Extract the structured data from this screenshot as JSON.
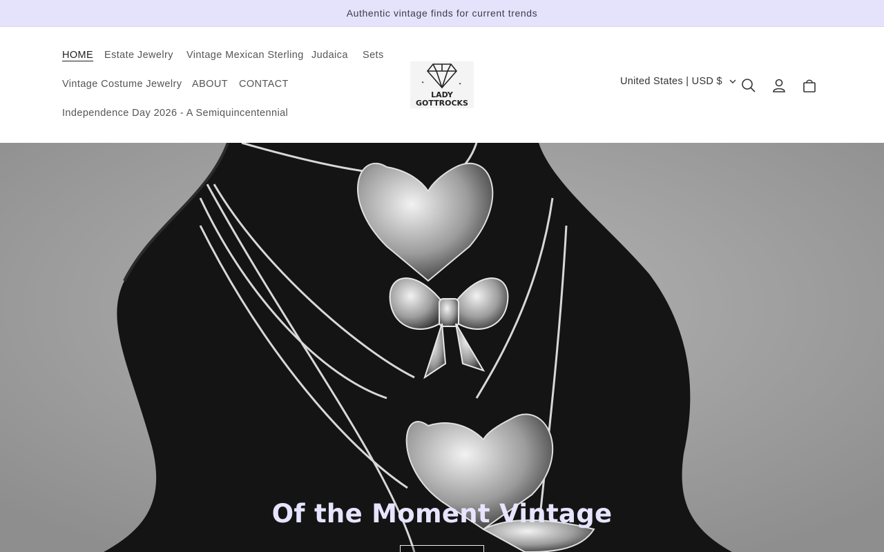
{
  "announcement": {
    "text": "Authentic vintage finds for current trends"
  },
  "nav": {
    "items": [
      {
        "label": "HOME",
        "active": true
      },
      {
        "label": "Estate Jewelry"
      },
      {
        "label": "Vintage Mexican Sterling"
      },
      {
        "label": "Judaica"
      },
      {
        "label": "Sets"
      },
      {
        "label": "Vintage Costume Jewelry"
      },
      {
        "label": "ABOUT"
      },
      {
        "label": "CONTACT"
      },
      {
        "label": "Independence Day 2026 - A Semiquincentennial"
      }
    ]
  },
  "logo": {
    "line1": "LADY",
    "line2": "GOTTROCKS",
    "icon": "diamond-icon"
  },
  "header_actions": {
    "country_selector": "United States | USD $",
    "icons": [
      "search-icon",
      "account-icon",
      "cart-icon"
    ]
  },
  "hero": {
    "title": "Of the Moment Vintage",
    "image_description_icon": "necklace-bust-image"
  },
  "colors": {
    "announcement_bg": "#e4e3fb",
    "hero_title": "#e6e4ff",
    "nav_text": "#555555"
  }
}
